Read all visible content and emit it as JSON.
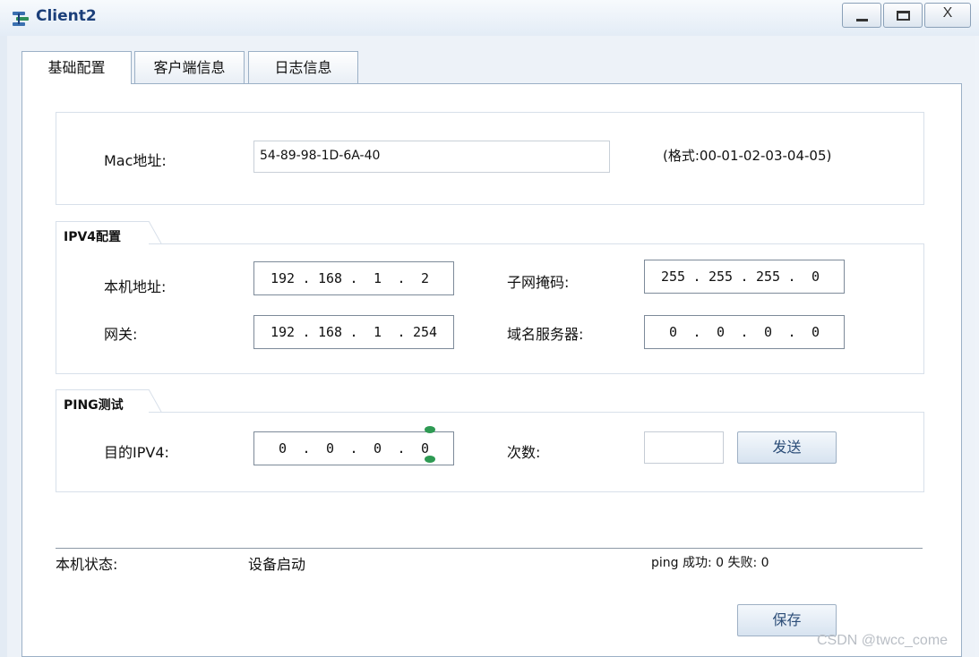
{
  "window": {
    "title": "Client2",
    "min_glyph": "_",
    "max_glyph": "□",
    "close_glyph": "X"
  },
  "tabs": [
    {
      "label": "基础配置"
    },
    {
      "label": "客户端信息"
    },
    {
      "label": "日志信息"
    }
  ],
  "mac": {
    "label": "Mac地址:",
    "value": "54-89-98-1D-6A-40",
    "hint": "(格式:00-01-02-03-04-05)"
  },
  "ipv4": {
    "legend": "IPV4配置",
    "local_label": "本机地址:",
    "local": [
      "192",
      "168",
      "1",
      "2"
    ],
    "mask_label": "子网掩码:",
    "mask": [
      "255",
      "255",
      "255",
      "0"
    ],
    "gateway_label": "网关:",
    "gateway": [
      "192",
      "168",
      "1",
      "254"
    ],
    "dns_label": "域名服务器:",
    "dns": [
      "0",
      "0",
      "0",
      "0"
    ]
  },
  "ping": {
    "legend": "PING测试",
    "dest_label": "目的IPV4:",
    "dest": [
      "0",
      "0",
      "0",
      "0"
    ],
    "count_label": "次数:",
    "count_value": "",
    "send_label": "发送"
  },
  "status": {
    "label": "本机状态:",
    "value": "设备启动",
    "ping_result": "ping 成功: 0 失败: 0"
  },
  "save_label": "保存",
  "watermark": "CSDN @twcc_come"
}
